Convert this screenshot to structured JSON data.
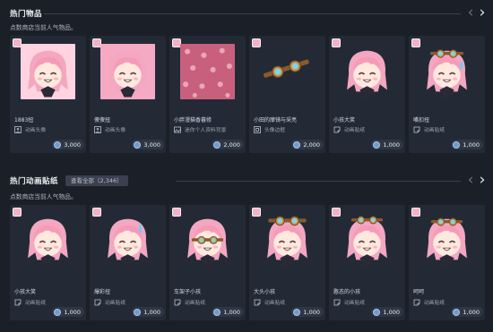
{
  "featured": {
    "title": "热门物品",
    "subtitle": "点数商店当前人气物品。",
    "items": [
      {
        "name": "1883扭",
        "type": "动画头像",
        "price": "3,000"
      },
      {
        "name": "傻傻扭",
        "type": "动画头像",
        "price": "3,000"
      },
      {
        "name": "小胖漫猫香暮修",
        "type": "迷你个人资料背景",
        "price": "2,000"
      },
      {
        "name": "小田的摩镜与采亮",
        "type": "头像边框",
        "price": "2,000"
      },
      {
        "name": "小孩大笑",
        "type": "动画贴纸",
        "price": "1,000"
      },
      {
        "name": "嘴扣扭",
        "type": "动画贴纸",
        "price": "1,000"
      }
    ]
  },
  "stickers": {
    "title": "热门动画贴纸",
    "view_all": "查看全部（2,346）",
    "subtitle": "点数商店当前人气物品。",
    "items": [
      {
        "name": "小孩大笑",
        "type": "动画贴纸",
        "price": "1,000"
      },
      {
        "name": "爆彩扭",
        "type": "动画贴纸",
        "price": "1,000"
      },
      {
        "name": "车架子小孩",
        "type": "动画贴纸",
        "price": "1,000"
      },
      {
        "name": "大头小孩",
        "type": "动画贴纸",
        "price": "1,000"
      },
      {
        "name": "憨态的小孩",
        "type": "动画贴纸",
        "price": "1,000"
      },
      {
        "name": "呵呵",
        "type": "动画贴纸",
        "price": "1,000"
      }
    ]
  },
  "icons": {
    "prev": "chevron-left-icon",
    "next": "chevron-right-icon",
    "currency": "points-coin-icon",
    "avatar_type": "avatar-icon",
    "background_type": "profile-background-icon",
    "frame_type": "avatar-frame-icon",
    "sticker_type": "sticker-icon"
  },
  "colors": {
    "page_bg": "#1b1f27",
    "card_bg": "#232a36",
    "hair_pink": "#f2a1bc",
    "coin_blue": "#6f9bcc"
  }
}
